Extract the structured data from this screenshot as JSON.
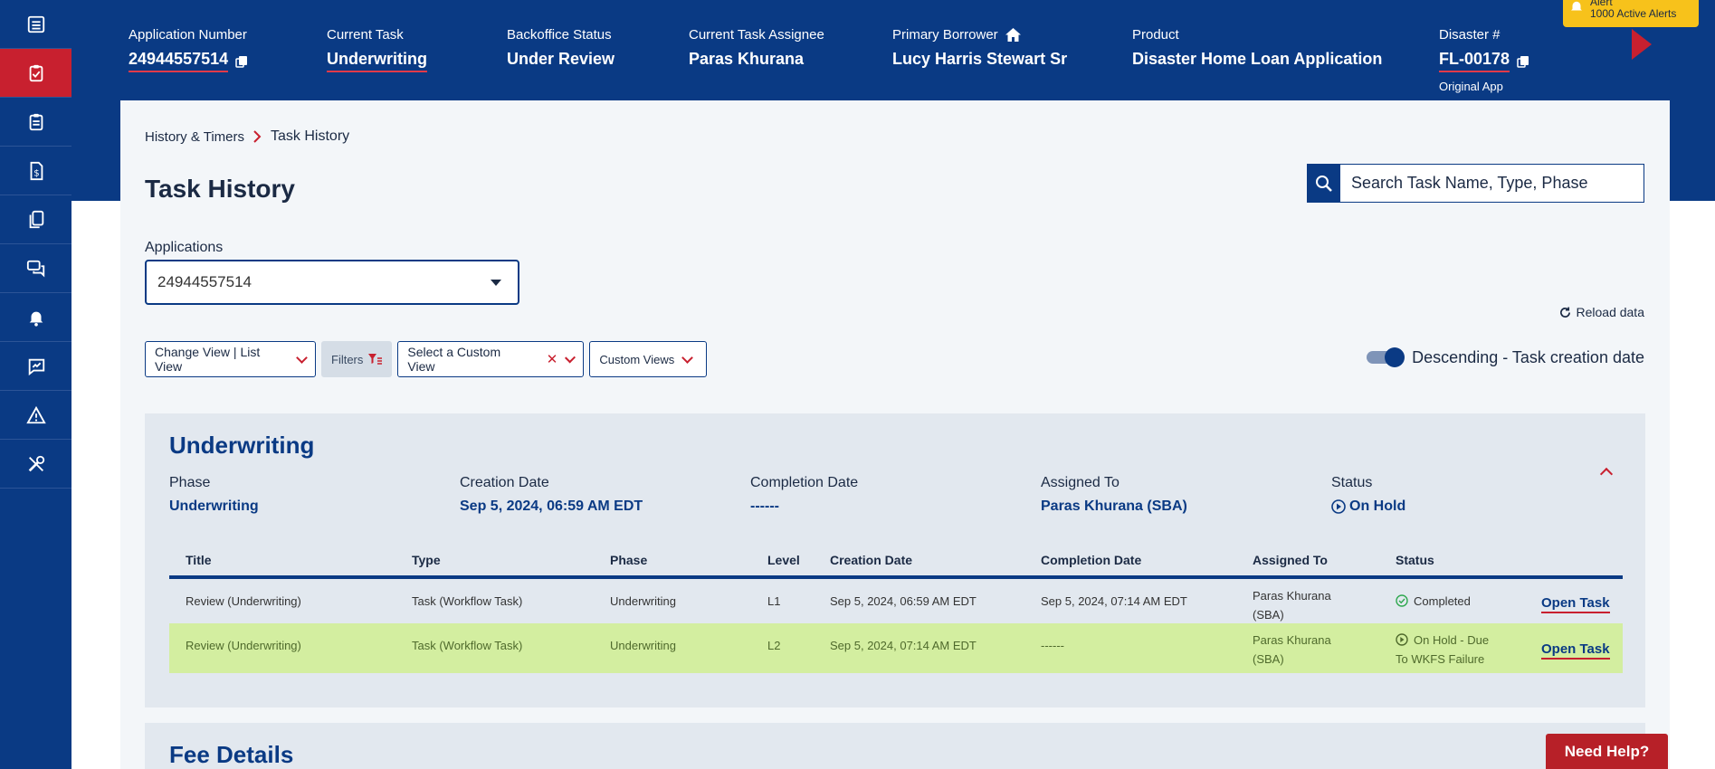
{
  "sidebar": {
    "items": [
      {
        "icon": "list-icon"
      },
      {
        "icon": "clipboard-check-icon",
        "active": true
      },
      {
        "icon": "clipboard-icon"
      },
      {
        "icon": "dollar-document-icon"
      },
      {
        "icon": "documents-icon"
      },
      {
        "icon": "chat-icon"
      },
      {
        "icon": "bell-icon"
      },
      {
        "icon": "chart-message-icon"
      },
      {
        "icon": "warning-icon"
      },
      {
        "icon": "tools-icon"
      }
    ]
  },
  "header": {
    "application_number": {
      "label": "Application Number",
      "value": "24944557514"
    },
    "current_task": {
      "label": "Current Task",
      "value": "Underwriting"
    },
    "backoffice_status": {
      "label": "Backoffice Status",
      "value": "Under Review"
    },
    "current_task_assignee": {
      "label": "Current Task Assignee",
      "value": "Paras Khurana"
    },
    "primary_borrower": {
      "label": "Primary Borrower",
      "value": "Lucy Harris Stewart Sr"
    },
    "product": {
      "label": "Product",
      "value": "Disaster Home Loan Application"
    },
    "disaster": {
      "label": "Disaster #",
      "value": "FL-00178",
      "sub": "Original App"
    },
    "alert": {
      "title": "Alert",
      "count_text": "1000 Active Alerts"
    }
  },
  "breadcrumb": {
    "parent": "History & Timers",
    "current": "Task History"
  },
  "page_title": "Task History",
  "search": {
    "placeholder": "Search Task Name, Type, Phase"
  },
  "applications": {
    "label": "Applications",
    "selected": "24944557514"
  },
  "reload_label": "Reload data",
  "toolbar": {
    "change_view": "Change View | List View",
    "filters": "Filters",
    "custom_view_select": "Select a Custom View",
    "custom_views": "Custom Views"
  },
  "sort": {
    "label": "Descending - Task creation date",
    "enabled": true
  },
  "panel": {
    "title": "Underwriting",
    "summary": {
      "phase": {
        "label": "Phase",
        "value": "Underwriting"
      },
      "creation_date": {
        "label": "Creation Date",
        "value": "Sep 5, 2024, 06:59 AM EDT"
      },
      "completion_date": {
        "label": "Completion Date",
        "value": "------"
      },
      "assigned_to": {
        "label": "Assigned To",
        "value": "Paras Khurana (SBA)"
      },
      "status": {
        "label": "Status",
        "value": "On Hold"
      }
    },
    "table": {
      "columns": [
        "Title",
        "Type",
        "Phase",
        "Level",
        "Creation Date",
        "Completion Date",
        "Assigned To",
        "Status"
      ],
      "rows": [
        {
          "title": "Review (Underwriting)",
          "type": "Task (Workflow Task)",
          "phase": "Underwriting",
          "level": "L1",
          "creation_date": "Sep 5, 2024, 06:59 AM EDT",
          "completion_date": "Sep 5, 2024, 07:14 AM EDT",
          "assigned_to_1": "Paras Khurana",
          "assigned_to_2": "(SBA)",
          "status_1": "Completed",
          "status_2": "",
          "action": "Open Task"
        },
        {
          "title": "Review (Underwriting)",
          "type": "Task (Workflow Task)",
          "phase": "Underwriting",
          "level": "L2",
          "creation_date": "Sep 5, 2024, 07:14 AM EDT",
          "completion_date": "------",
          "assigned_to_1": "Paras Khurana",
          "assigned_to_2": "(SBA)",
          "status_1": "On Hold - Due",
          "status_2": "To WKFS Failure",
          "action": "Open Task"
        }
      ]
    }
  },
  "fee_panel": {
    "title": "Fee Details"
  },
  "need_help": "Need Help?",
  "colors": {
    "primary": "#0a3a84",
    "accent": "#c8202f",
    "highlight_row": "#d3eea0",
    "alert": "#f7c21b"
  }
}
